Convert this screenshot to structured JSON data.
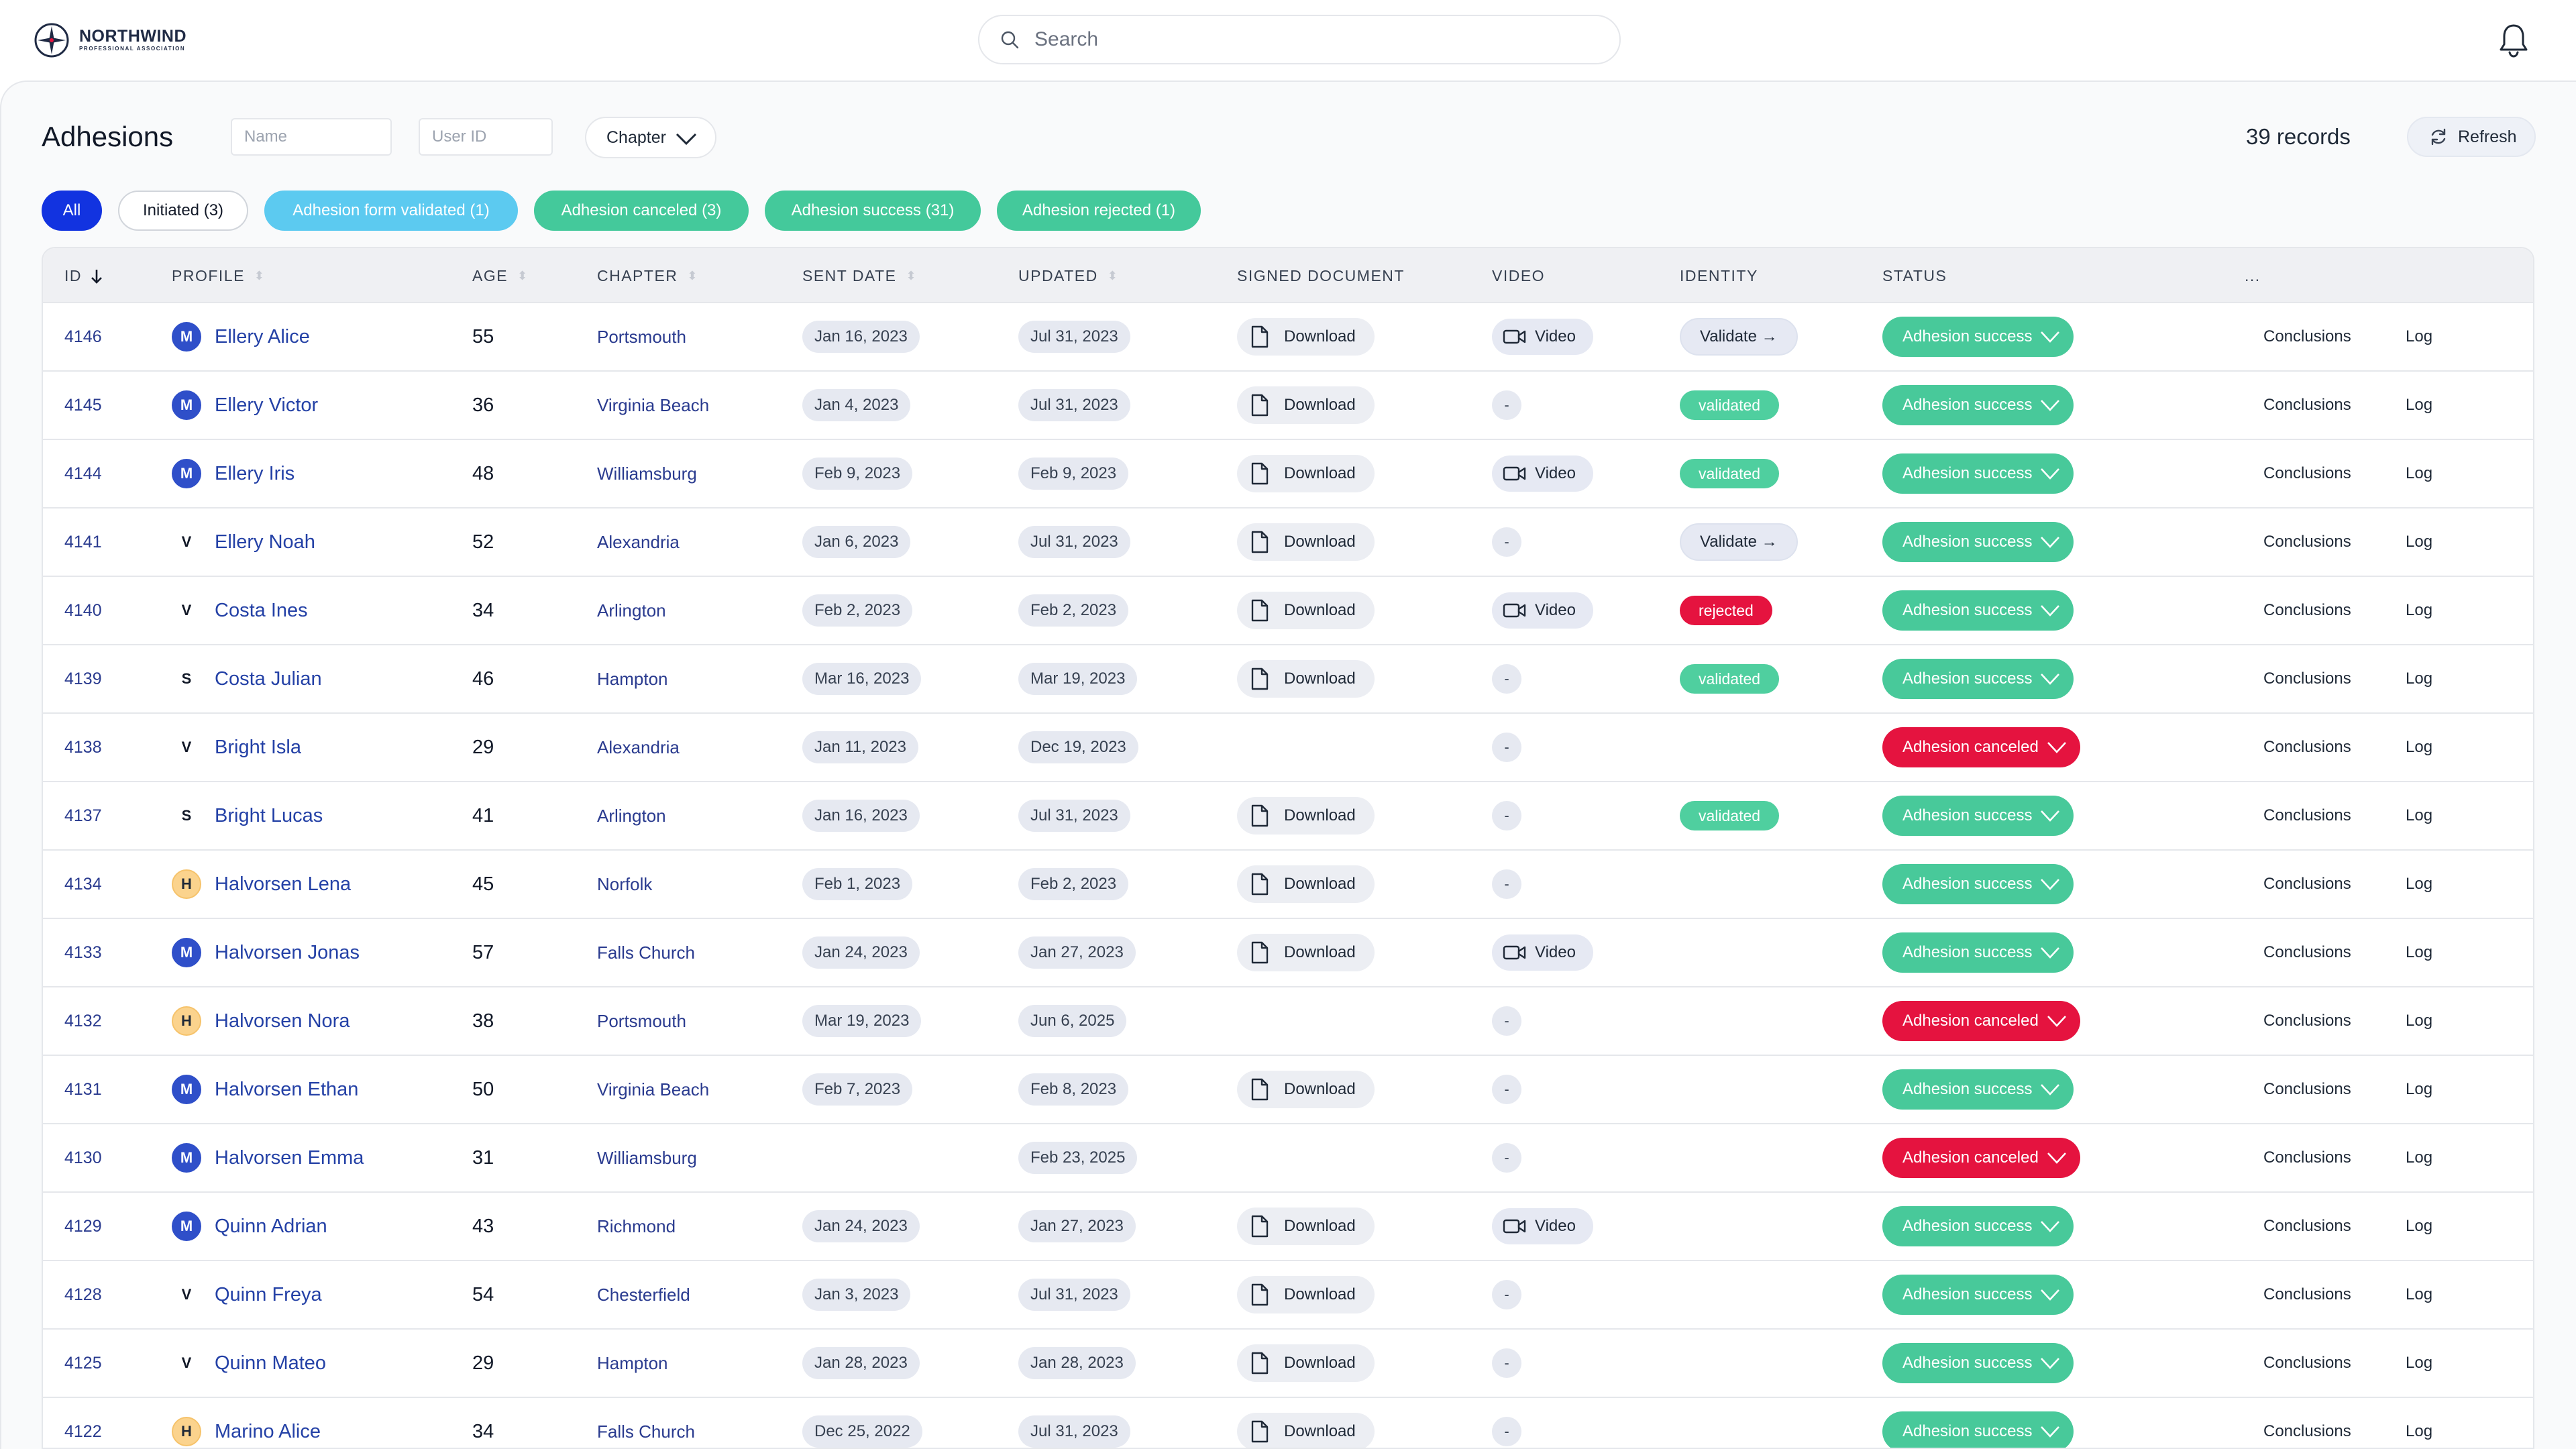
{
  "brand": {
    "name": "NORTHWIND",
    "tagline": "PROFESSIONAL ASSOCIATION"
  },
  "search": {
    "placeholder": "Search",
    "value": ""
  },
  "page": {
    "title": "Adhesions",
    "name_filter_placeholder": "Name",
    "user_id_filter_placeholder": "User ID",
    "chapter_select_label": "Chapter",
    "records_label": "39 records",
    "refresh_label": "Refresh"
  },
  "filters": [
    {
      "label": "All",
      "bg": "#1233e0",
      "fg": "#ffffff",
      "border": "#1233e0"
    },
    {
      "label": "Initiated (3)",
      "bg": "#ffffff",
      "fg": "#111827",
      "border": "#d1d5db"
    },
    {
      "label": "Adhesion form validated (1)",
      "bg": "#5ccaf0",
      "fg": "#ffffff",
      "border": "#5ccaf0"
    },
    {
      "label": "Adhesion canceled (3)",
      "bg": "#44c99b",
      "fg": "#ffffff",
      "border": "#44c99b"
    },
    {
      "label": "Adhesion success (31)",
      "bg": "#44c99b",
      "fg": "#ffffff",
      "border": "#44c99b"
    },
    {
      "label": "Adhesion rejected (1)",
      "bg": "#44c99b",
      "fg": "#ffffff",
      "border": "#44c99b"
    }
  ],
  "columns": [
    {
      "label": "ID",
      "sort": "active"
    },
    {
      "label": "PROFILE",
      "sort": "inactive"
    },
    {
      "label": "AGE",
      "sort": "inactive"
    },
    {
      "label": "CHAPTER",
      "sort": "inactive"
    },
    {
      "label": "SENT DATE",
      "sort": "inactive"
    },
    {
      "label": "UPDATED",
      "sort": "inactive"
    },
    {
      "label": "SIGNED DOCUMENT",
      "sort": "none"
    },
    {
      "label": "VIDEO",
      "sort": "none"
    },
    {
      "label": "IDENTITY",
      "sort": "none"
    },
    {
      "label": "STATUS",
      "sort": "none"
    },
    {
      "label": "...",
      "sort": "none"
    }
  ],
  "avatar_styles": {
    "M": {
      "bg": "#2f4fc9",
      "fg": "#ffffff",
      "border": "#2f4fc9"
    },
    "V": {
      "bg": "#ffffff",
      "fg": "#111827",
      "border": "#ffffff"
    },
    "S": {
      "bg": "#ffffff",
      "fg": "#111827",
      "border": "#ffffff"
    },
    "H": {
      "bg": "#fbd38d",
      "fg": "#1f2937",
      "border": "#f6c36b"
    }
  },
  "labels": {
    "download": "Download",
    "video": "Video",
    "dash": "-",
    "validate": "Validate →",
    "validated": "validated",
    "rejected": "rejected",
    "conclusions": "Conclusions",
    "log": "Log"
  },
  "rows": [
    {
      "id": "4146",
      "initial": "M",
      "name": "Ellery Alice",
      "age": "55",
      "chapter": "Portsmouth",
      "sent": "Jan 16, 2023",
      "updated": "Jul 31, 2023",
      "doc": true,
      "video": "video",
      "identity": "validate",
      "status": "Adhesion success"
    },
    {
      "id": "4145",
      "initial": "M",
      "name": "Ellery Victor",
      "age": "36",
      "chapter": "Virginia Beach",
      "sent": "Jan 4, 2023",
      "updated": "Jul 31, 2023",
      "doc": true,
      "video": "dash",
      "identity": "validated",
      "status": "Adhesion success"
    },
    {
      "id": "4144",
      "initial": "M",
      "name": "Ellery Iris",
      "age": "48",
      "chapter": "Williamsburg",
      "sent": "Feb 9, 2023",
      "updated": "Feb 9, 2023",
      "doc": true,
      "video": "video",
      "identity": "validated",
      "status": "Adhesion success"
    },
    {
      "id": "4141",
      "initial": "V",
      "name": "Ellery Noah",
      "age": "52",
      "chapter": "Alexandria",
      "sent": "Jan 6, 2023",
      "updated": "Jul 31, 2023",
      "doc": true,
      "video": "dash",
      "identity": "validate",
      "status": "Adhesion success"
    },
    {
      "id": "4140",
      "initial": "V",
      "name": "Costa Ines",
      "age": "34",
      "chapter": "Arlington",
      "sent": "Feb 2, 2023",
      "updated": "Feb 2, 2023",
      "doc": true,
      "video": "video",
      "identity": "rejected",
      "status": "Adhesion success"
    },
    {
      "id": "4139",
      "initial": "S",
      "name": "Costa Julian",
      "age": "46",
      "chapter": "Hampton",
      "sent": "Mar 16, 2023",
      "updated": "Mar 19, 2023",
      "doc": true,
      "video": "dash",
      "identity": "validated",
      "status": "Adhesion success"
    },
    {
      "id": "4138",
      "initial": "V",
      "name": "Bright Isla",
      "age": "29",
      "chapter": "Alexandria",
      "sent": "Jan 11, 2023",
      "updated": "Dec 19, 2023",
      "doc": false,
      "video": "dash",
      "identity": "",
      "status": "Adhesion canceled"
    },
    {
      "id": "4137",
      "initial": "S",
      "name": "Bright Lucas",
      "age": "41",
      "chapter": "Arlington",
      "sent": "Jan 16, 2023",
      "updated": "Jul 31, 2023",
      "doc": true,
      "video": "dash",
      "identity": "validated",
      "status": "Adhesion success"
    },
    {
      "id": "4134",
      "initial": "H",
      "name": "Halvorsen Lena",
      "age": "45",
      "chapter": "Norfolk",
      "sent": "Feb 1, 2023",
      "updated": "Feb 2, 2023",
      "doc": true,
      "video": "dash",
      "identity": "",
      "status": "Adhesion success"
    },
    {
      "id": "4133",
      "initial": "M",
      "name": "Halvorsen Jonas",
      "age": "57",
      "chapter": "Falls Church",
      "sent": "Jan 24, 2023",
      "updated": "Jan 27, 2023",
      "doc": true,
      "video": "video",
      "identity": "",
      "status": "Adhesion success"
    },
    {
      "id": "4132",
      "initial": "H",
      "name": "Halvorsen Nora",
      "age": "38",
      "chapter": "Portsmouth",
      "sent": "Mar 19, 2023",
      "updated": "Jun 6, 2025",
      "doc": false,
      "video": "dash",
      "identity": "",
      "status": "Adhesion canceled"
    },
    {
      "id": "4131",
      "initial": "M",
      "name": "Halvorsen Ethan",
      "age": "50",
      "chapter": "Virginia Beach",
      "sent": "Feb 7, 2023",
      "updated": "Feb 8, 2023",
      "doc": true,
      "video": "dash",
      "identity": "",
      "status": "Adhesion success"
    },
    {
      "id": "4130",
      "initial": "M",
      "name": "Halvorsen Emma",
      "age": "31",
      "chapter": "Williamsburg",
      "sent": "",
      "updated": "Feb 23, 2025",
      "doc": false,
      "video": "dash",
      "identity": "",
      "status": "Adhesion canceled"
    },
    {
      "id": "4129",
      "initial": "M",
      "name": "Quinn Adrian",
      "age": "43",
      "chapter": "Richmond",
      "sent": "Jan 24, 2023",
      "updated": "Jan 27, 2023",
      "doc": true,
      "video": "video",
      "identity": "",
      "status": "Adhesion success"
    },
    {
      "id": "4128",
      "initial": "V",
      "name": "Quinn Freya",
      "age": "54",
      "chapter": "Chesterfield",
      "sent": "Jan 3, 2023",
      "updated": "Jul 31, 2023",
      "doc": true,
      "video": "dash",
      "identity": "",
      "status": "Adhesion success"
    },
    {
      "id": "4125",
      "initial": "V",
      "name": "Quinn Mateo",
      "age": "29",
      "chapter": "Hampton",
      "sent": "Jan 28, 2023",
      "updated": "Jan 28, 2023",
      "doc": true,
      "video": "dash",
      "identity": "",
      "status": "Adhesion success"
    },
    {
      "id": "4122",
      "initial": "H",
      "name": "Marino Alice",
      "age": "34",
      "chapter": "Falls Church",
      "sent": "Dec 25, 2022",
      "updated": "Jul 31, 2023",
      "doc": true,
      "video": "dash",
      "identity": "",
      "status": "Adhesion success"
    }
  ]
}
